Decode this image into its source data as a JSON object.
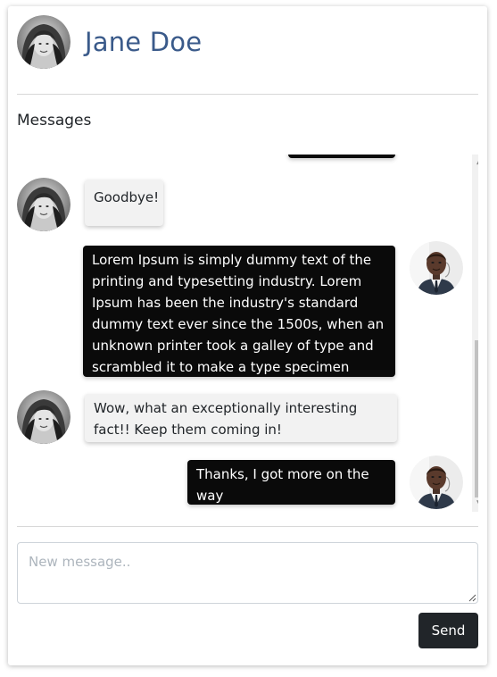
{
  "contact": {
    "name": "Jane Doe",
    "avatar": "jane-avatar"
  },
  "section_title": "Messages",
  "messages": [
    {
      "sender": "me",
      "text": ""
    },
    {
      "sender": "them",
      "text": "Goodbye!"
    },
    {
      "sender": "me",
      "text": "Lorem Ipsum is simply dummy text of the printing and typesetting industry. Lorem Ipsum has been the industry's standard dummy text ever since the 1500s, when an unknown printer took a galley of type and scrambled it to make a type specimen book."
    },
    {
      "sender": "them",
      "text": "Wow, what an exceptionally interesting fact!! Keep them coming in!"
    },
    {
      "sender": "me",
      "text": "Thanks, I got more on the way"
    }
  ],
  "composer": {
    "placeholder": "New message..",
    "value": "",
    "send_label": "Send"
  },
  "colors": {
    "name": "#3a5a8a",
    "my_bubble": "#0a0a0a",
    "their_bubble": "#f2f2f2",
    "send_button": "#212529"
  },
  "icons": {
    "scroll_up": "scroll-up-arrow-icon",
    "scroll_down": "scroll-down-arrow-icon",
    "resize": "resize-grip-icon"
  }
}
